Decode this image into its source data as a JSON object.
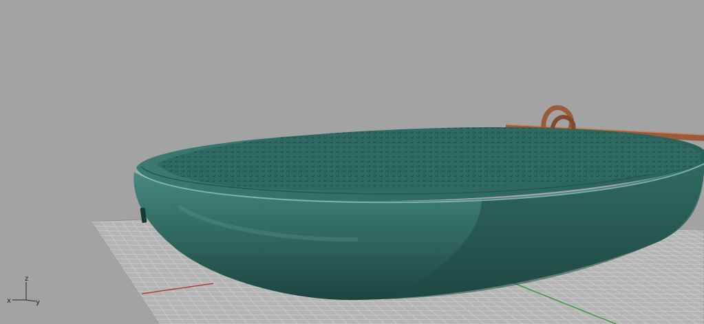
{
  "viewport": {
    "background": "#a3a3a3",
    "grid_color": "#bdbdbd",
    "grid_border_color": "#8f8f8f",
    "x_axis_color": "#b43c3c",
    "y_axis_color": "#3a9a3a"
  },
  "model": {
    "body_color": "#2f6b62",
    "body_highlight": "#4f8d83",
    "body_shadow": "#1e4842",
    "grille_color": "#2a5f57",
    "strap_color": "#9b5b3a"
  },
  "axis_widget": {
    "icon": "axis-triad-icon",
    "z_label": "z",
    "x_label": "x",
    "y_label": "y"
  }
}
